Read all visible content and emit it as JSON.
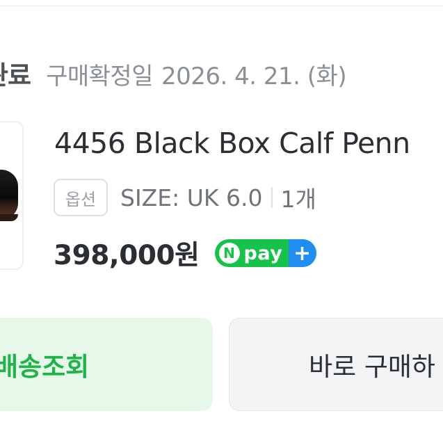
{
  "order": {
    "status_label": "완료",
    "confirm_label": "구매확정일",
    "confirm_date": "2026. 4. 21. (화)"
  },
  "product": {
    "name": "4456 Black Box Calf Penn",
    "option_badge": "옵션",
    "option_text": "SIZE: UK 6.0",
    "quantity": "1개",
    "price": "398,000원"
  },
  "payment": {
    "badge_n": "N",
    "badge_text": "pay",
    "badge_plus": "+"
  },
  "actions": {
    "track_label": "배송조회",
    "rebuy_label": "바로 구매하"
  },
  "colors": {
    "npay_green": "#17c24a",
    "npay_blue": "#1f8ef0",
    "track_bg": "#e6f8ea",
    "track_text": "#20b348",
    "rebuy_bg": "#f3f4f6"
  },
  "icons": {
    "product_image": "shoe-thumbnail"
  }
}
